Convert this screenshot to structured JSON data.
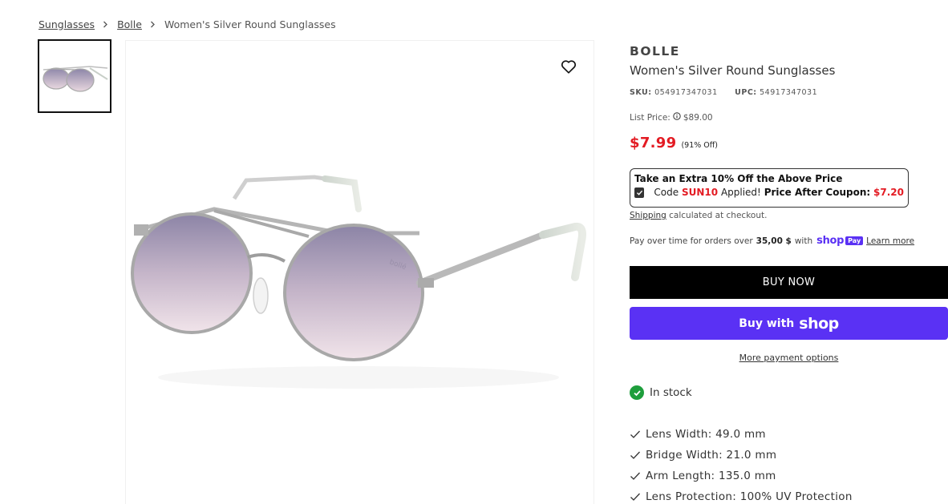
{
  "breadcrumb": {
    "items": [
      "Sunglasses",
      "Bolle"
    ],
    "current": "Women's Silver Round Sunglasses"
  },
  "product": {
    "brand": "BOLLE",
    "title": "Women's Silver Round Sunglasses",
    "sku_label": "SKU:",
    "sku": "054917347031",
    "upc_label": "UPC:",
    "upc": "54917347031",
    "list_price_label": "List Price:",
    "list_price": "$89.00",
    "sale_price": "$7.99",
    "discount": "(91% Off)",
    "image_brand_mark": "bollé"
  },
  "coupon": {
    "title": "Take an Extra 10% Off the Above Price",
    "code_prefix": "Code",
    "code": "SUN10",
    "applied": "Applied!",
    "after_label": "Price After Coupon:",
    "after_price": "$7.20"
  },
  "shipping": {
    "link": "Shipping",
    "text": "calculated at checkout."
  },
  "installments": {
    "prefix": "Pay over time for orders over",
    "amount": "35,00 $",
    "with": "with",
    "shop_word": "shop",
    "pay_badge": "Pay",
    "learn_more": "Learn more"
  },
  "buttons": {
    "buy_now": "BUY NOW",
    "buy_with": "Buy with",
    "shop": "shop",
    "more_options": "More payment options"
  },
  "stock": {
    "label": "In stock"
  },
  "specs": [
    "Lens Width: 49.0 mm",
    "Bridge Width: 21.0 mm",
    "Arm Length: 135.0 mm",
    "Lens Protection: 100% UV Protection"
  ],
  "colors": {
    "sale_red": "#e31b23",
    "shop_purple": "#5a31f4",
    "stock_green": "#1e9e3c"
  }
}
